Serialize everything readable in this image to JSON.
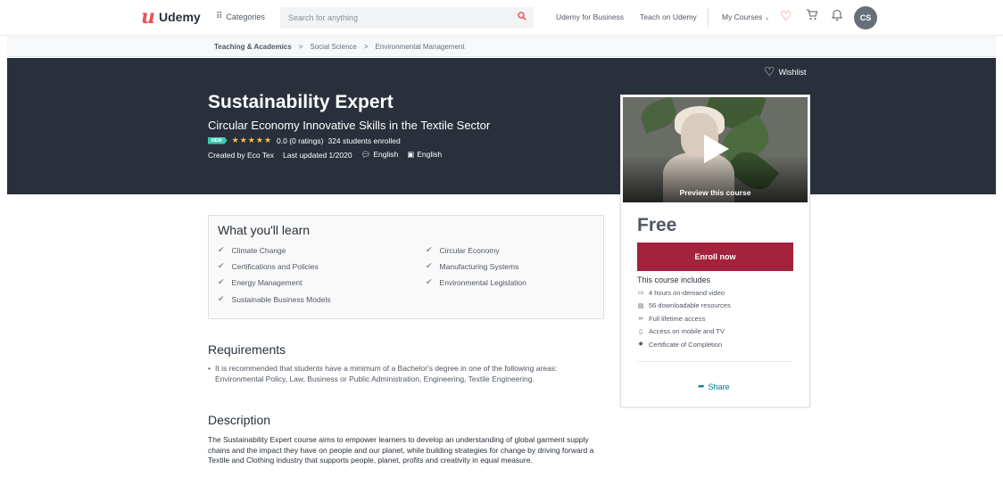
{
  "header": {
    "logo_text": "Udemy",
    "categories_label": "Categories",
    "search_placeholder": "Search for anything",
    "udemy_for_business": "Udemy for Business",
    "teach_on_udemy": "Teach on Udemy",
    "my_courses": "My Courses",
    "avatar_initials": "CS"
  },
  "breadcrumb": {
    "items": [
      "Teaching & Academics",
      "Social Science",
      "Environmental Management"
    ],
    "separator": ">"
  },
  "hero": {
    "wishlist_label": "Wishlist",
    "title": "Sustainability Expert",
    "subtitle": "Circular Economy Innovative Skills in the Textile Sector",
    "new_badge": "NEW",
    "rating_text": "0.0 (0 ratings)",
    "students_text": "324 students enrolled",
    "created_by": "Created by Eco Tex",
    "last_updated": "Last updated 1/2020",
    "audio_language": "English",
    "caption_language": "English"
  },
  "card": {
    "preview_label": "Preview this course",
    "price": "Free",
    "enroll_label": "Enroll now",
    "includes_title": "This course includes",
    "includes": [
      {
        "icon": "video-icon",
        "text": "4 hours on-demand video"
      },
      {
        "icon": "file-icon",
        "text": "56 downloadable resources"
      },
      {
        "icon": "infinity-icon",
        "text": "Full lifetime access"
      },
      {
        "icon": "mobile-icon",
        "text": "Access on mobile and TV"
      },
      {
        "icon": "certificate-icon",
        "text": "Certificate of Completion"
      }
    ],
    "share_label": "Share"
  },
  "learn": {
    "title": "What you'll learn",
    "left": [
      "Climate Change",
      "Certifications and Policies",
      "Energy Management",
      "Sustainable Business Models"
    ],
    "right": [
      "Circular Economy",
      "Manufacturing Systems",
      "Environmental Legislation"
    ]
  },
  "requirements": {
    "title": "Requirements",
    "items": [
      "It is recommended that students have a minimum of a Bachelor's degree in one of the following areas: Environmental Policy, Law, Business or Public Administration, Engineering, Textile Engineering."
    ]
  },
  "description": {
    "title": "Description",
    "text": "The Sustainability Expert course aims to empower learners to develop an understanding of global garment supply chains and the impact they have on people and our planet, while building strategies for change by driving forward a Textile and Clothing industry that supports people, planet, profits and creativity in equal measure."
  },
  "colors": {
    "brand": "#ec5252",
    "hero_bg": "#29303b",
    "enroll": "#a1233c",
    "link": "#007791",
    "stars": "#f4c150",
    "new_badge": "#3dcbb1"
  }
}
